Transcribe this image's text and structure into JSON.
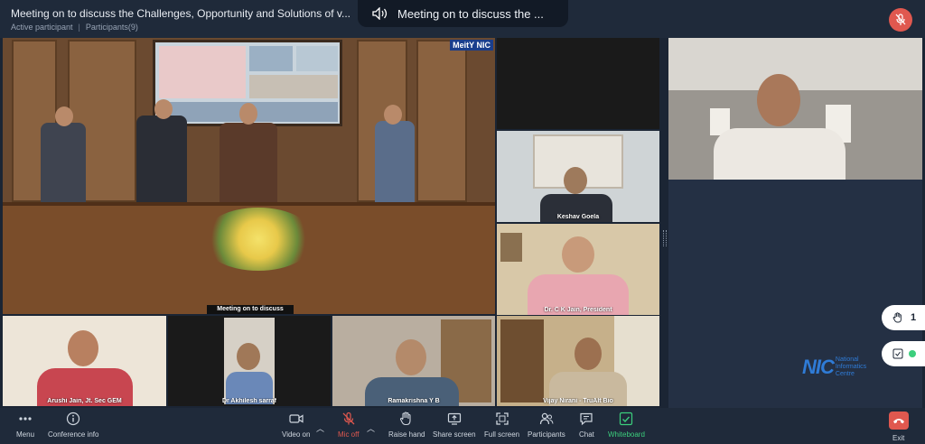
{
  "header": {
    "title": "Meeting on to discuss the Challenges, Opportunity and Solutions of v...",
    "status": "Active participant",
    "participants": "Participants(9)",
    "active_speaker": "Meeting on to discuss the ..."
  },
  "main_room": {
    "logo_text": "MeitY NIC",
    "caption": "Meeting on to discuss"
  },
  "tiles": [
    {
      "id": "keshav",
      "name": "Keshav Goela"
    },
    {
      "id": "ckjain",
      "name": "Dr. C K Jain, President"
    },
    {
      "id": "arushi",
      "name": "Arushi Jain, Jt. Sec GEM"
    },
    {
      "id": "akhilesh",
      "name": "Dr Akhilesh sarraf"
    },
    {
      "id": "rama",
      "name": "Ramakrishna Y B"
    },
    {
      "id": "vijay",
      "name": "Vijay Nirani - TruAlt Bio"
    }
  ],
  "side": {
    "raised_hands": "1",
    "nic_name": "NIC",
    "nic_sub1": "National",
    "nic_sub2": "Informatics",
    "nic_sub3": "Centre"
  },
  "toolbar": {
    "menu": "Menu",
    "conference_info": "Conference info",
    "video_on": "Video on",
    "mic_off": "Mic off",
    "raise_hand": "Raise hand",
    "share_screen": "Share screen",
    "full_screen": "Full screen",
    "participants": "Participants",
    "chat": "Chat",
    "whiteboard": "Whiteboard",
    "exit": "Exit"
  },
  "colors": {
    "accent_red": "#e0584f",
    "accent_green": "#3ccf7d",
    "background": "#1b2534"
  }
}
